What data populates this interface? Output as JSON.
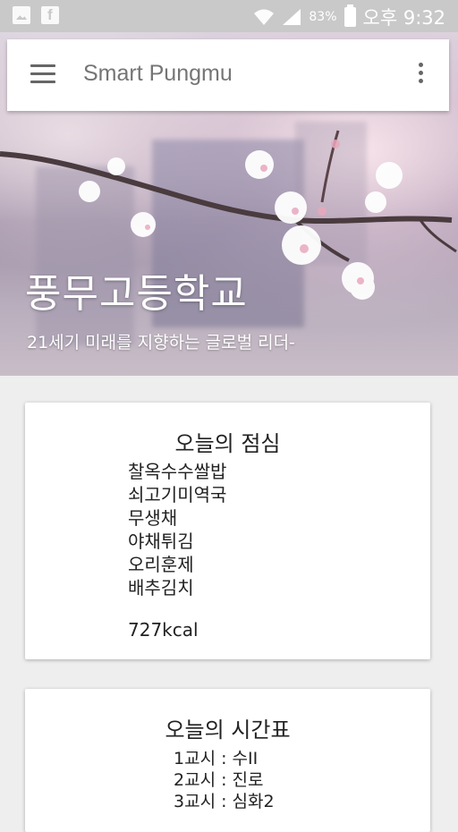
{
  "status_bar": {
    "icons_left": [
      "gallery-icon",
      "facebook-icon"
    ],
    "battery_percent": "83%",
    "time": "오후 9:32"
  },
  "app_bar": {
    "title": "Smart Pungmu",
    "menu_icon": "hamburger-menu-icon",
    "overflow_icon": "more-vert-icon"
  },
  "hero": {
    "title": "풍무고등학교",
    "subtitle": "21세기 미래를 지향하는 글로벌 리더-"
  },
  "lunch": {
    "title": "오늘의 점심",
    "items": [
      "찰옥수수쌀밥",
      "쇠고기미역국",
      "무생채",
      "야채튀김",
      "오리훈제",
      "배추김치"
    ],
    "calories": "727kcal"
  },
  "schedule": {
    "title": "오늘의 시간표",
    "periods": [
      "1교시 : 수II",
      "2교시 : 진로",
      "3교시 : 심화2"
    ]
  }
}
